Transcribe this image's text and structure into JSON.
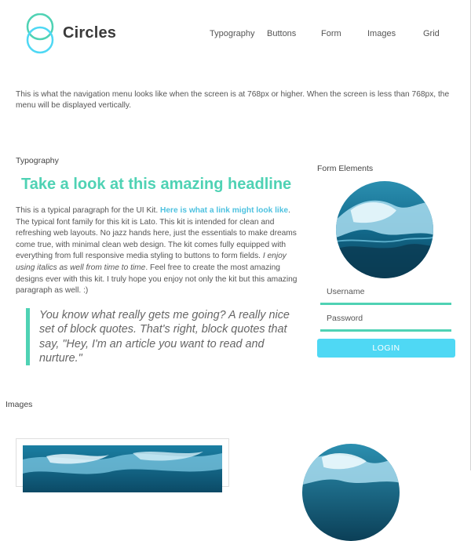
{
  "header": {
    "brand": "Circles",
    "logo_icon": "interlocking-circles-icon",
    "accent_color": "#4fd2b4",
    "nav": [
      "Typography",
      "Buttons",
      "Form",
      "Images",
      "Grid"
    ]
  },
  "intro": "This is what the navigation menu looks like when the screen is at 768px or higher. When the screen is less than 768px, the menu will be displayed vertically.",
  "typography": {
    "section_label": "Typography",
    "headline": "Take a look at this amazing headline",
    "paragraph": {
      "part1": "This is a typical paragraph for the UI Kit. ",
      "link": "Here is what a link might look like",
      "part2": ". The typical font family for this kit is Lato. This kit is intended for clean and refreshing web layouts. No jazz hands here, just the essentials to make dreams come true, with minimal clean web design. The kit comes fully equipped with everything from full responsive media styling to buttons to form fields. ",
      "italic": "I enjoy using italics as well from time to time",
      "part3": ". Feel free to create the most amazing designs ever with this kit. I truly hope you enjoy not only the kit but this amazing paragraph as well. :)"
    },
    "blockquote": "You know what really gets me going? A really nice set of block quotes. That's right, block quotes that say, \"Hey, I'm an article you want to read and nurture.\""
  },
  "form": {
    "section_label": "Form Elements",
    "username_placeholder": "Username",
    "password_placeholder": "Password",
    "login_label": "LOGIN",
    "button_color": "#4fd8f4"
  },
  "images": {
    "section_label": "Images"
  }
}
